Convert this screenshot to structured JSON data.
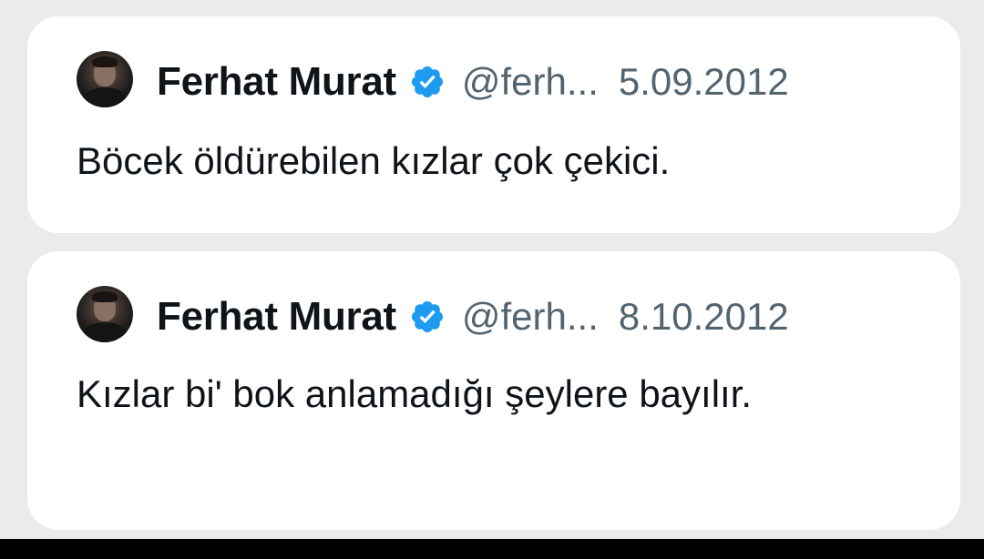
{
  "tweets": [
    {
      "author_name": "Ferhat Murat",
      "verified_icon": "verified-badge-icon",
      "handle": "@ferh...",
      "date": "5.09.2012",
      "text": "Böcek öldürebilen kızlar çok çekici."
    },
    {
      "author_name": "Ferhat Murat",
      "verified_icon": "verified-badge-icon",
      "handle": "@ferh...",
      "date": "8.10.2012",
      "text": "Kızlar bi' bok anlamadığı şeylere bayılır."
    }
  ],
  "colors": {
    "background": "#ebebeb",
    "card": "#ffffff",
    "verified_blue": "#1d9bf0",
    "secondary_text": "#536471",
    "primary_text": "#0f1419"
  }
}
